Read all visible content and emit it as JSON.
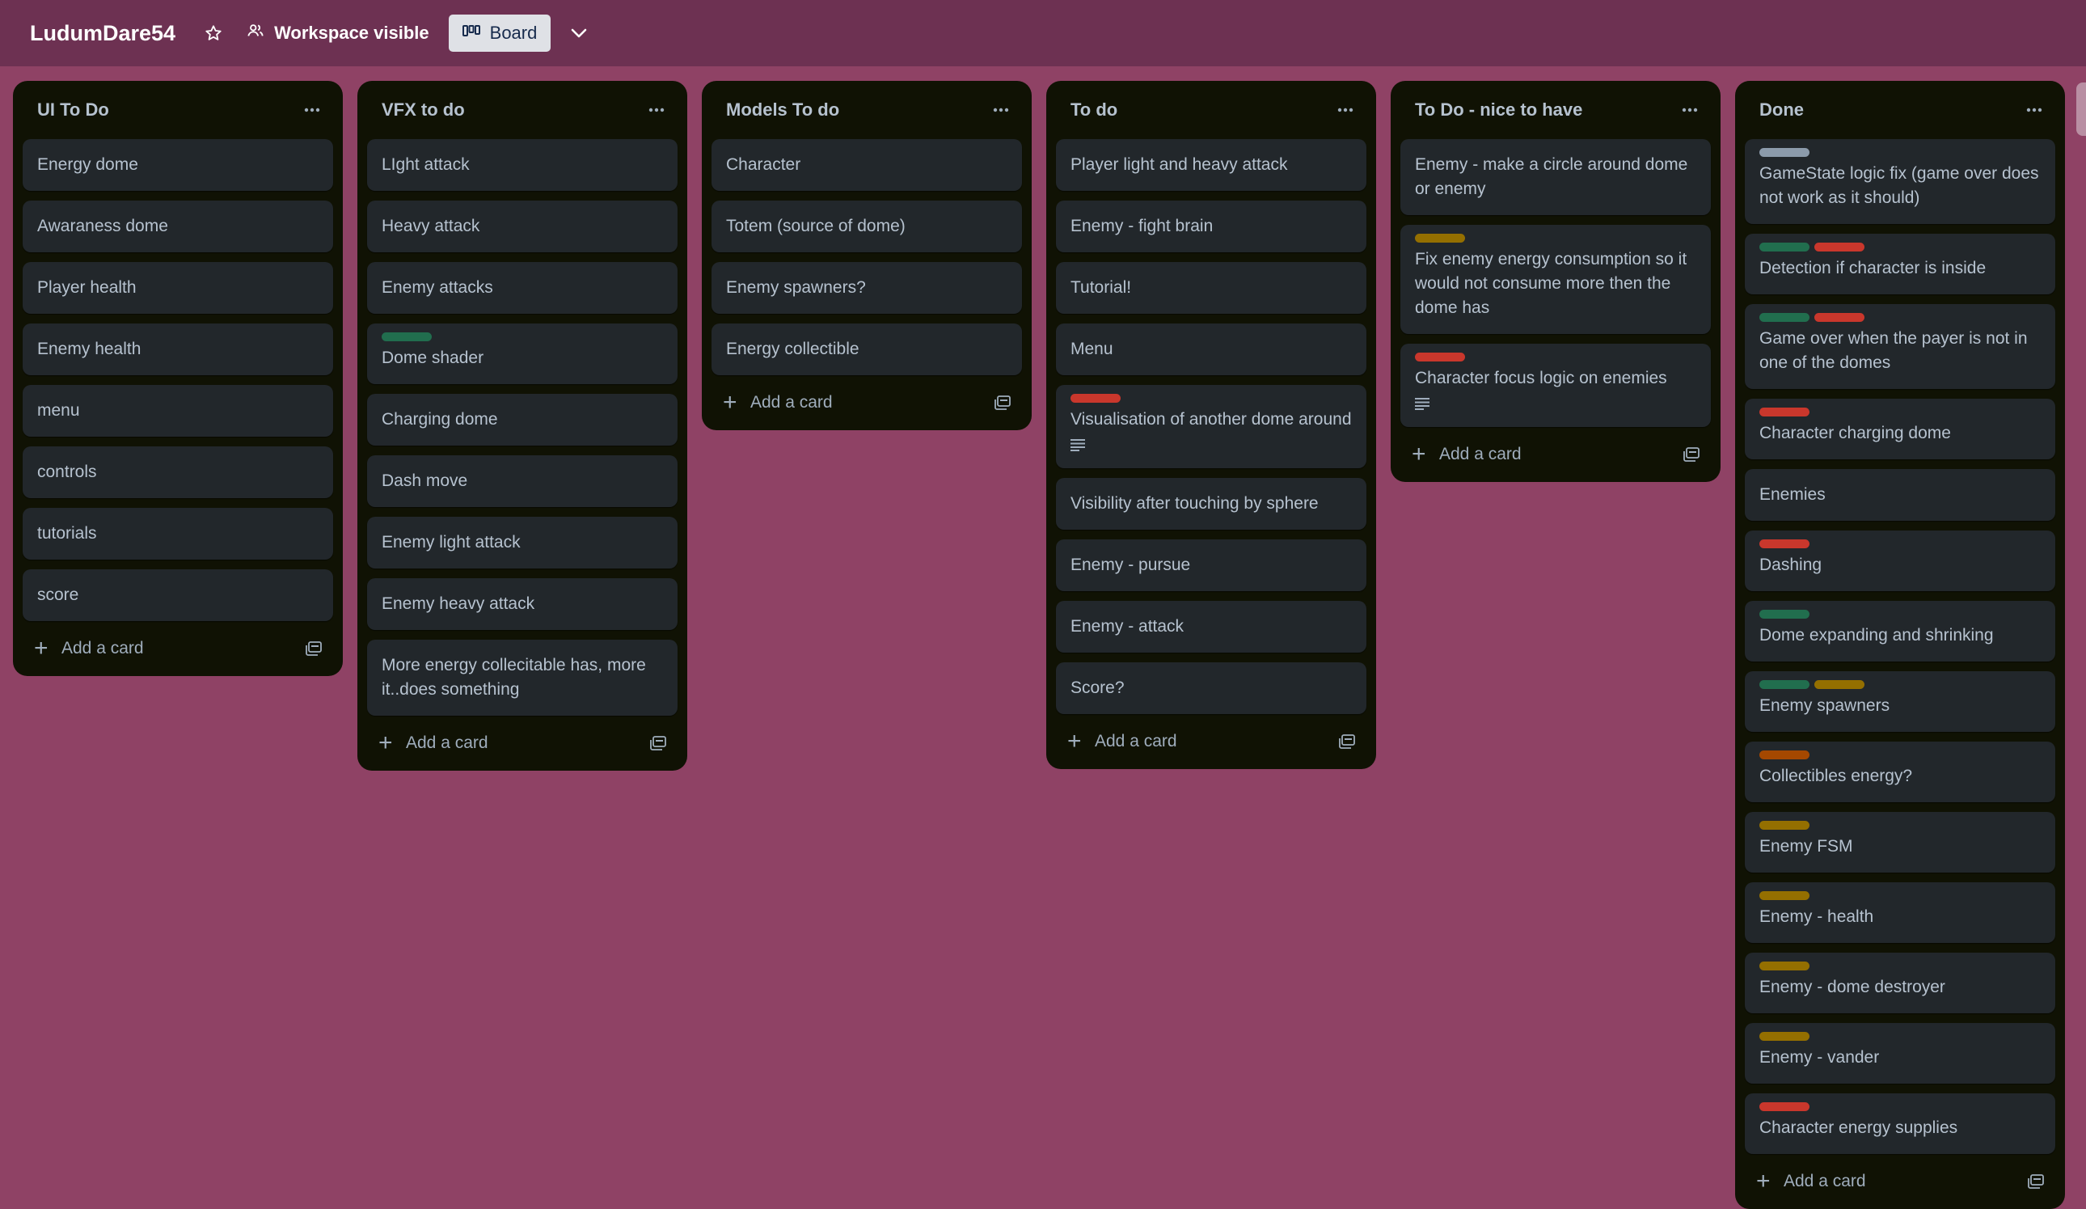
{
  "header": {
    "board_title": "LudumDare54",
    "visibility_label": "Workspace visible",
    "view_label": "Board"
  },
  "colors": {
    "background": "#8f4265",
    "header": "#6d3152",
    "list": "#101204",
    "card": "#22272b",
    "label_green": "#216e4e",
    "label_red": "#c9372c",
    "label_yellow": "#946f00",
    "label_orange": "#a54800",
    "label_gray": "#8c9bab"
  },
  "add_card_label": "Add a card",
  "lists": [
    {
      "title": "UI To Do",
      "cards": [
        {
          "title": "Energy dome",
          "labels": []
        },
        {
          "title": "Awaraness dome",
          "labels": []
        },
        {
          "title": "Player health",
          "labels": []
        },
        {
          "title": "Enemy health",
          "labels": []
        },
        {
          "title": "menu",
          "labels": []
        },
        {
          "title": "controls",
          "labels": []
        },
        {
          "title": "tutorials",
          "labels": []
        },
        {
          "title": "score",
          "labels": []
        }
      ]
    },
    {
      "title": "VFX to do",
      "cards": [
        {
          "title": "LIght attack",
          "labels": []
        },
        {
          "title": "Heavy attack",
          "labels": []
        },
        {
          "title": "Enemy attacks",
          "labels": []
        },
        {
          "title": "Dome shader",
          "labels": [
            "#216e4e"
          ]
        },
        {
          "title": "Charging dome",
          "labels": []
        },
        {
          "title": "Dash move",
          "labels": []
        },
        {
          "title": "Enemy light attack",
          "labels": []
        },
        {
          "title": "Enemy heavy attack",
          "labels": []
        },
        {
          "title": "More energy collecitable has, more it..does something",
          "labels": []
        }
      ]
    },
    {
      "title": "Models To do",
      "cards": [
        {
          "title": "Character",
          "labels": []
        },
        {
          "title": "Totem (source of dome)",
          "labels": []
        },
        {
          "title": "Enemy spawners?",
          "labels": []
        },
        {
          "title": "Energy collectible",
          "labels": []
        }
      ]
    },
    {
      "title": "To do",
      "cards": [
        {
          "title": "Player light and heavy attack",
          "labels": []
        },
        {
          "title": "Enemy - fight brain",
          "labels": []
        },
        {
          "title": "Tutorial!",
          "labels": []
        },
        {
          "title": "Menu",
          "labels": []
        },
        {
          "title": "Visualisation of another dome around",
          "labels": [
            "#c9372c"
          ],
          "has_description": true
        },
        {
          "title": "Visibility after touching by sphere",
          "labels": []
        },
        {
          "title": "Enemy - pursue",
          "labels": []
        },
        {
          "title": "Enemy - attack",
          "labels": []
        },
        {
          "title": "Score?",
          "labels": []
        }
      ]
    },
    {
      "title": "To Do - nice to have",
      "cards": [
        {
          "title": "Enemy - make a circle around dome or enemy",
          "labels": []
        },
        {
          "title": "Fix enemy energy consumption so it would not consume more then the dome has",
          "labels": [
            "#946f00"
          ]
        },
        {
          "title": "Character focus logic on enemies",
          "labels": [
            "#c9372c"
          ],
          "has_description": true
        }
      ]
    },
    {
      "title": "Done",
      "cards": [
        {
          "title": "GameState logic fix (game over does not work as it should)",
          "labels": [
            "#8c9bab"
          ]
        },
        {
          "title": "Detection if character is inside",
          "labels": [
            "#216e4e",
            "#c9372c"
          ]
        },
        {
          "title": "Game over when the payer is not in one of the domes",
          "labels": [
            "#216e4e",
            "#c9372c"
          ]
        },
        {
          "title": "Character charging dome",
          "labels": [
            "#c9372c"
          ]
        },
        {
          "title": "Enemies",
          "labels": []
        },
        {
          "title": "Dashing",
          "labels": [
            "#c9372c"
          ]
        },
        {
          "title": "Dome expanding and shrinking",
          "labels": [
            "#216e4e"
          ]
        },
        {
          "title": "Enemy spawners",
          "labels": [
            "#216e4e",
            "#946f00"
          ]
        },
        {
          "title": "Collectibles energy?",
          "labels": [
            "#a54800"
          ]
        },
        {
          "title": "Enemy FSM",
          "labels": [
            "#946f00"
          ]
        },
        {
          "title": "Enemy - health",
          "labels": [
            "#946f00"
          ]
        },
        {
          "title": "Enemy - dome destroyer",
          "labels": [
            "#946f00"
          ]
        },
        {
          "title": "Enemy - vander",
          "labels": [
            "#946f00"
          ]
        },
        {
          "title": "Character energy supplies",
          "labels": [
            "#c9372c"
          ]
        }
      ]
    }
  ]
}
